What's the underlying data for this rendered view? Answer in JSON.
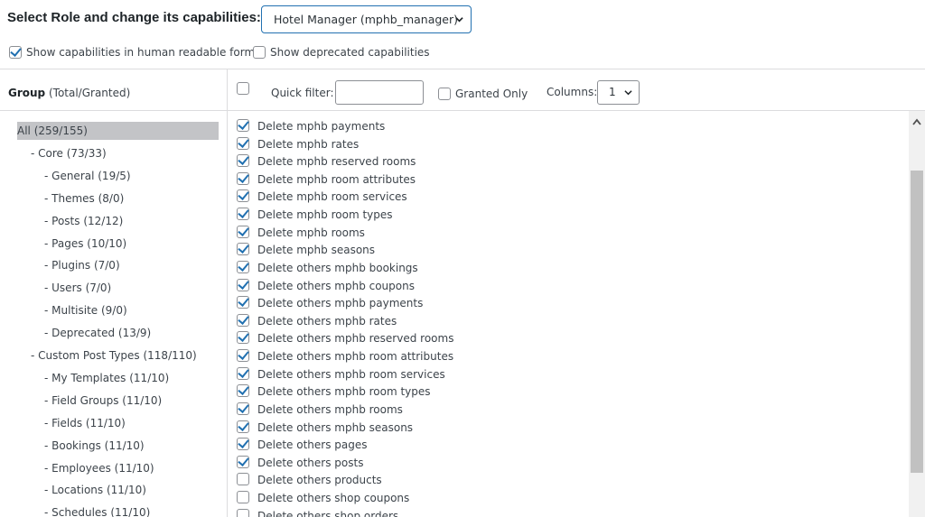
{
  "header": {
    "title": "Select Role and change its capabilities:",
    "role_select_value": "Hotel Manager (mphb_manager)"
  },
  "options": {
    "human_readable": {
      "label": "Show capabilities in human readable form",
      "checked": true
    },
    "deprecated": {
      "label": "Show deprecated capabilities",
      "checked": false
    }
  },
  "group_panel": {
    "heading_bold": "Group",
    "heading_rest": " (Total/Granted)",
    "items": [
      {
        "label": "All (259/155)",
        "level": 0,
        "selected": true
      },
      {
        "label": "- Core (73/33)",
        "level": 1
      },
      {
        "label": "- General (19/5)",
        "level": 2
      },
      {
        "label": "- Themes (8/0)",
        "level": 2
      },
      {
        "label": "- Posts (12/12)",
        "level": 2
      },
      {
        "label": "- Pages (10/10)",
        "level": 2
      },
      {
        "label": "- Plugins (7/0)",
        "level": 2
      },
      {
        "label": "- Users (7/0)",
        "level": 2
      },
      {
        "label": "- Multisite (9/0)",
        "level": 2
      },
      {
        "label": "- Deprecated (13/9)",
        "level": 2
      },
      {
        "label": "- Custom Post Types (118/110)",
        "level": 1
      },
      {
        "label": "- My Templates (11/10)",
        "level": 2
      },
      {
        "label": "- Field Groups (11/10)",
        "level": 2
      },
      {
        "label": "- Fields (11/10)",
        "level": 2
      },
      {
        "label": "- Bookings (11/10)",
        "level": 2
      },
      {
        "label": "- Employees (11/10)",
        "level": 2
      },
      {
        "label": "- Locations (11/10)",
        "level": 2
      },
      {
        "label": "- Schedules (11/10)",
        "level": 2
      }
    ]
  },
  "filter_bar": {
    "quick_filter_label": "Quick filter:",
    "quick_filter_value": "",
    "granted_only_label": "Granted Only",
    "columns_label": "Columns:",
    "columns_value": "1"
  },
  "capabilities": [
    {
      "label": "Delete mphb payments",
      "checked": true
    },
    {
      "label": "Delete mphb rates",
      "checked": true
    },
    {
      "label": "Delete mphb reserved rooms",
      "checked": true
    },
    {
      "label": "Delete mphb room attributes",
      "checked": true
    },
    {
      "label": "Delete mphb room services",
      "checked": true
    },
    {
      "label": "Delete mphb room types",
      "checked": true
    },
    {
      "label": "Delete mphb rooms",
      "checked": true
    },
    {
      "label": "Delete mphb seasons",
      "checked": true
    },
    {
      "label": "Delete others mphb bookings",
      "checked": true
    },
    {
      "label": "Delete others mphb coupons",
      "checked": true
    },
    {
      "label": "Delete others mphb payments",
      "checked": true
    },
    {
      "label": "Delete others mphb rates",
      "checked": true
    },
    {
      "label": "Delete others mphb reserved rooms",
      "checked": true
    },
    {
      "label": "Delete others mphb room attributes",
      "checked": true
    },
    {
      "label": "Delete others mphb room services",
      "checked": true
    },
    {
      "label": "Delete others mphb room types",
      "checked": true
    },
    {
      "label": "Delete others mphb rooms",
      "checked": true
    },
    {
      "label": "Delete others mphb seasons",
      "checked": true
    },
    {
      "label": "Delete others pages",
      "checked": true
    },
    {
      "label": "Delete others posts",
      "checked": true
    },
    {
      "label": "Delete others products",
      "checked": false
    },
    {
      "label": "Delete others shop coupons",
      "checked": false
    },
    {
      "label": "Delete others shop orders",
      "checked": false
    }
  ]
}
